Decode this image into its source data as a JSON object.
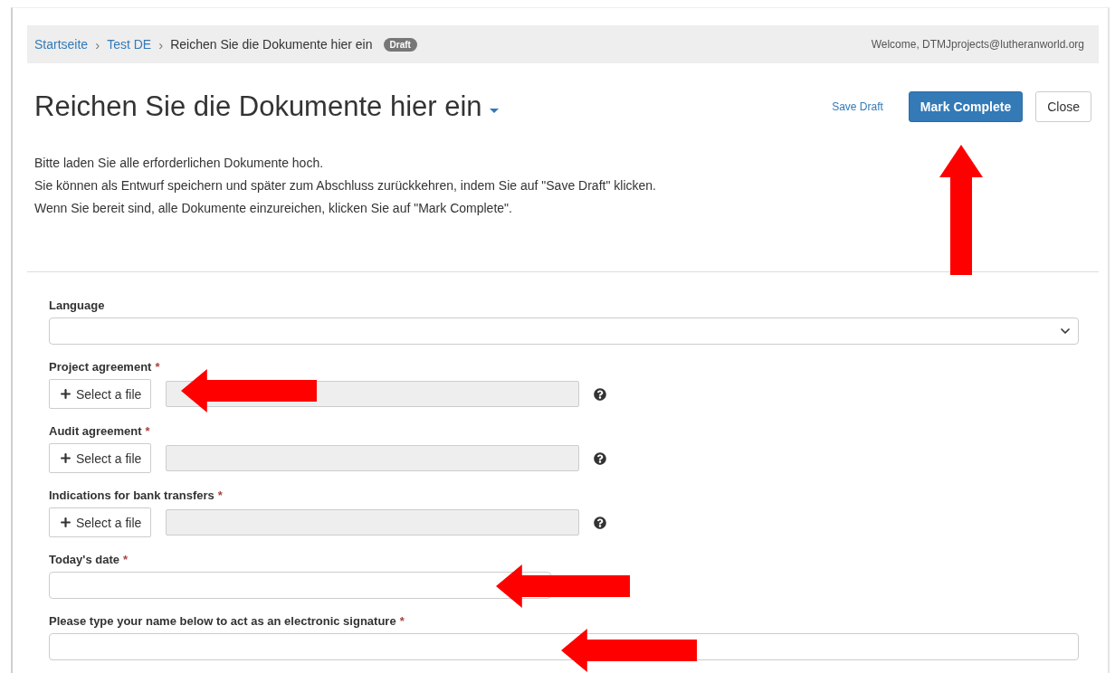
{
  "breadcrumb": {
    "items": [
      {
        "label": "Startseite",
        "kind": "link",
        "separator": "›"
      },
      {
        "label": "Test DE",
        "kind": "link",
        "separator": "›"
      },
      {
        "label": "Reichen Sie die Dokumente hier ein",
        "kind": "current"
      }
    ],
    "badge": "Draft",
    "user": "Welcome, DTMJprojects@lutheranworld.org"
  },
  "title": "Reichen Sie die Dokumente hier ein",
  "actions": {
    "save_draft": "Save Draft",
    "mark_complete": "Mark Complete",
    "close": "Close"
  },
  "description": [
    "Bitte laden Sie alle erforderlichen Dokumente hoch.",
    "Sie können als Entwurf speichern und später zum Abschluss zurückkehren, indem Sie auf \"Save Draft\" klicken.",
    "Wenn Sie bereit sind, alle Dokumente einzureichen, klicken Sie auf \"Mark Complete\"."
  ],
  "fields": [
    {
      "kind": "select",
      "label": "Language"
    },
    {
      "kind": "file",
      "label": "Project agreement",
      "required_mark": "*",
      "button": "Select a file"
    },
    {
      "kind": "file",
      "label": "Audit agreement",
      "required_mark": "*",
      "button": "Select a file"
    },
    {
      "kind": "file",
      "label": "Indications for bank transfers",
      "required_mark": "*",
      "button": "Select a file"
    },
    {
      "kind": "date",
      "label": "Today's date",
      "required_mark": "*"
    },
    {
      "kind": "text",
      "label": "Please type your name below to act as an electronic signature",
      "required_mark": "*"
    }
  ]
}
